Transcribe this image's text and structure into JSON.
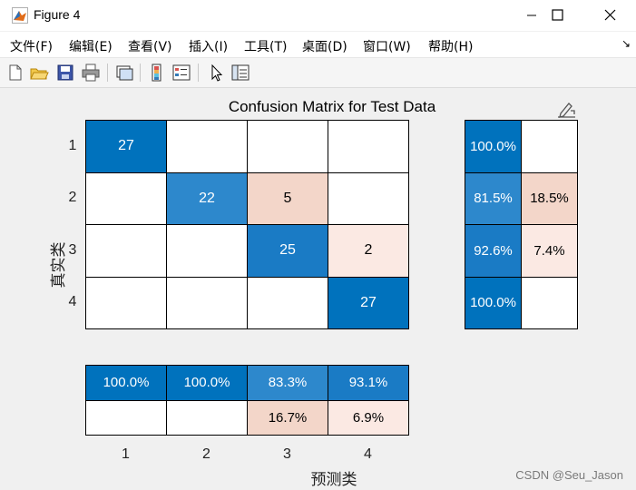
{
  "window": {
    "title": "Figure 4",
    "controls": [
      "minimize",
      "maximize",
      "close"
    ]
  },
  "menubar": {
    "items": [
      "文件(F)",
      "编辑(E)",
      "查看(V)",
      "插入(I)",
      "工具(T)",
      "桌面(D)",
      "窗口(W)",
      "帮助(H)"
    ],
    "expand": "↘"
  },
  "toolbar": {
    "icons": [
      "new-figure-icon",
      "open-folder-icon",
      "save-icon",
      "print-icon",
      "link-plot-icon",
      "colorbar-icon",
      "legend-icon",
      "pointer-icon",
      "property-inspector-icon"
    ]
  },
  "figure": {
    "title": "Confusion Matrix for Test Data",
    "ylabel": "真实类",
    "xlabel": "预测类",
    "watermark": "CSDN @Seu_Jason"
  },
  "chart_data": {
    "type": "heatmap",
    "title": "Confusion Matrix for Test Data",
    "xlabel": "预测类",
    "ylabel": "真实类",
    "row_labels": [
      "1",
      "2",
      "3",
      "4"
    ],
    "col_labels": [
      "1",
      "2",
      "3",
      "4"
    ],
    "matrix": [
      [
        27,
        null,
        null,
        null
      ],
      [
        null,
        22,
        5,
        null
      ],
      [
        null,
        null,
        25,
        2
      ],
      [
        null,
        null,
        null,
        27
      ]
    ],
    "row_summary": [
      [
        "100.0%",
        ""
      ],
      [
        "81.5%",
        "18.5%"
      ],
      [
        "92.6%",
        "7.4%"
      ],
      [
        "100.0%",
        ""
      ]
    ],
    "column_summary": [
      [
        "100.0%",
        "100.0%",
        "83.3%",
        "93.1%"
      ],
      [
        "",
        "",
        "16.7%",
        "6.9%"
      ]
    ],
    "colors": {
      "correct_strong": "#0072bd",
      "correct_mid": "#2d88cc",
      "correct_light": "#1a7bc5",
      "error_strong": "#f3d6c9",
      "error_light": "#fbe9e3",
      "empty": "#ffffff"
    }
  }
}
